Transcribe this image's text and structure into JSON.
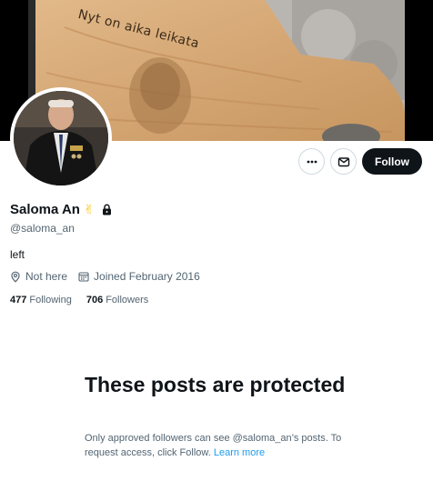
{
  "banner": {
    "engraved_text": "Nyt on aika leikata"
  },
  "profile": {
    "display_name": "Saloma An",
    "name_emoji": "✌",
    "handle": "@saloma_an",
    "bio": "left",
    "location": "Not here",
    "joined": "Joined February 2016",
    "following_count": "477",
    "following_label": "Following",
    "followers_count": "706",
    "followers_label": "Followers"
  },
  "actions": {
    "follow_label": "Follow"
  },
  "protected": {
    "title": "These posts are protected",
    "message": "Only approved followers can see @saloma_an’s posts. To request access, click Follow.",
    "learn_more": "Learn more"
  },
  "colors": {
    "accent": "#1d9bf0",
    "primary_text": "#0f1419",
    "secondary_text": "#536471",
    "follow_button": "#0f1419"
  }
}
